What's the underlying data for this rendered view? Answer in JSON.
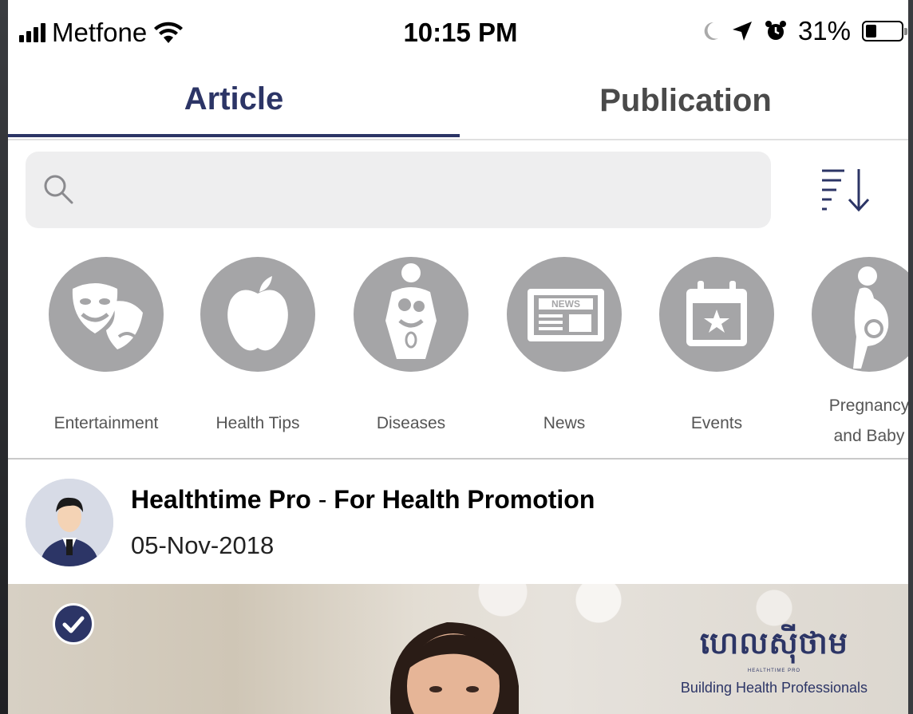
{
  "status_bar": {
    "carrier": "Metfone",
    "time": "10:15 PM",
    "battery_percent": "31%",
    "battery_level": 0.31
  },
  "tabs": [
    {
      "label": "Article",
      "active": true
    },
    {
      "label": "Publication",
      "active": false
    }
  ],
  "search": {
    "placeholder": "",
    "value": ""
  },
  "categories": [
    {
      "label": "Entertainment",
      "icon": "theater-masks-icon"
    },
    {
      "label": "Health Tips",
      "icon": "apple-icon"
    },
    {
      "label": "Diseases",
      "icon": "body-organs-icon"
    },
    {
      "label": "News",
      "icon": "newspaper-icon"
    },
    {
      "label": "Events",
      "icon": "calendar-star-icon"
    },
    {
      "label_line1": "Pregnancy",
      "label_line2": "and Baby",
      "icon": "pregnancy-icon"
    }
  ],
  "post": {
    "author": "Healthtime Pro",
    "separator": "-",
    "subtitle": "For Health Promotion",
    "date": "05-Nov-2018"
  },
  "hero": {
    "logo_khmer": "ហេលស៊ីថាម",
    "logo_small": "HEALTHTIME PRO",
    "logo_tagline": "Building Health Professionals"
  },
  "colors": {
    "accent": "#2c3566",
    "category_circle": "#a5a5a7",
    "search_bg": "#eeeeef"
  }
}
